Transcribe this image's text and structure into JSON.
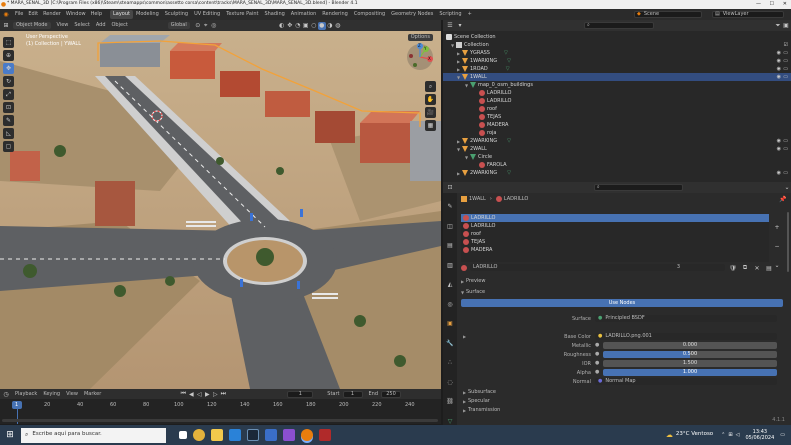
{
  "window": {
    "title": "* MARA_SENAL_3D [C:\\Program Files (x86)\\Steam\\steamapps\\common\\assetto corsa\\content\\tracks\\MARA_SENAL_3D\\MARA_SENAL_3D.blend] - Blender 4.1",
    "minimize": "—",
    "maximize": "☐",
    "close": "✕"
  },
  "topbar": {
    "menus": [
      "File",
      "Edit",
      "Render",
      "Window",
      "Help"
    ],
    "workspaces": [
      "Layout",
      "Modeling",
      "Sculpting",
      "UV Editing",
      "Texture Paint",
      "Shading",
      "Animation",
      "Rendering",
      "Compositing",
      "Geometry Nodes",
      "Scripting"
    ],
    "active_workspace": "Layout",
    "scene_label": "Scene",
    "viewlayer_label": "ViewLayer"
  },
  "viewport_header": {
    "mode": "Object Mode",
    "menus": [
      "View",
      "Select",
      "Add",
      "Object"
    ],
    "orientation_label": "Orientation:",
    "orientation_value": "Default",
    "drag_label": "Drag:",
    "drag_value": "Select Box",
    "transform": "Global",
    "options": "Options"
  },
  "viewport": {
    "line1": "User Perspective",
    "line2": "(1) Collection | YWALL",
    "gizmo_x": "X",
    "gizmo_y": "Y",
    "gizmo_z": "Z"
  },
  "outliner": {
    "search_placeholder": "",
    "items": [
      {
        "label": "Scene Collection"
      },
      {
        "label": "Collection"
      },
      {
        "label": "YGRASS"
      },
      {
        "label": "1WARKING"
      },
      {
        "label": "1ROAD"
      },
      {
        "label": "1WALL"
      },
      {
        "label": "map_0_osm_buildings"
      },
      {
        "label": "LADRILLO"
      },
      {
        "label": "LADRILLO"
      },
      {
        "label": "roof"
      },
      {
        "label": "TEJAS"
      },
      {
        "label": "MADERA"
      },
      {
        "label": "roja"
      },
      {
        "label": "2WARKING"
      },
      {
        "label": "2WALL"
      },
      {
        "label": "Circle"
      },
      {
        "label": "FAROLA"
      },
      {
        "label": "2WARKING"
      }
    ]
  },
  "properties": {
    "breadcrumb_object": "1WALL",
    "breadcrumb_material": "LADRILLO",
    "slots": [
      "LADRILLO",
      "LADRILLO",
      "roof",
      "TEJAS",
      "MADERA"
    ],
    "material_name": "LADRILLO",
    "user_count": "3",
    "preview_label": "Preview",
    "surface_label": "Surface",
    "use_nodes": "Use Nodes",
    "fields": [
      {
        "label": "Surface",
        "value": "Principled BSDF"
      },
      {
        "label": "Base Color",
        "value": "LADRILLO.png.001"
      },
      {
        "label": "Metallic",
        "value": "0.000"
      },
      {
        "label": "Roughness",
        "value": "0.500"
      },
      {
        "label": "IOR",
        "value": "1.500"
      },
      {
        "label": "Alpha",
        "value": "1.000"
      },
      {
        "label": "Normal",
        "value": "Normal Map"
      }
    ],
    "sections": [
      "Subsurface",
      "Specular",
      "Transmission"
    ],
    "version": "4.1.1"
  },
  "timeline": {
    "menus": [
      "Playback",
      "Keying",
      "View",
      "Marker"
    ],
    "current_frame": "1",
    "start_label": "Start",
    "start_value": "1",
    "end_label": "End",
    "end_value": "250",
    "ticks": [
      "1",
      "20",
      "40",
      "60",
      "80",
      "100",
      "120",
      "140",
      "160",
      "180",
      "200",
      "220",
      "240"
    ]
  },
  "taskbar": {
    "search_placeholder": "Escribe aquí para buscar.",
    "weather": "23°C  Ventoso",
    "time": "13:43",
    "date": "05/06/2024"
  },
  "colors": {
    "accent": "#4772b3",
    "selection": "#334d80",
    "collection_icon": "#d0d0d0",
    "mesh_icon": "#e8a040",
    "material_icon": "#c85050",
    "modifier_icon": "#4aa070"
  }
}
